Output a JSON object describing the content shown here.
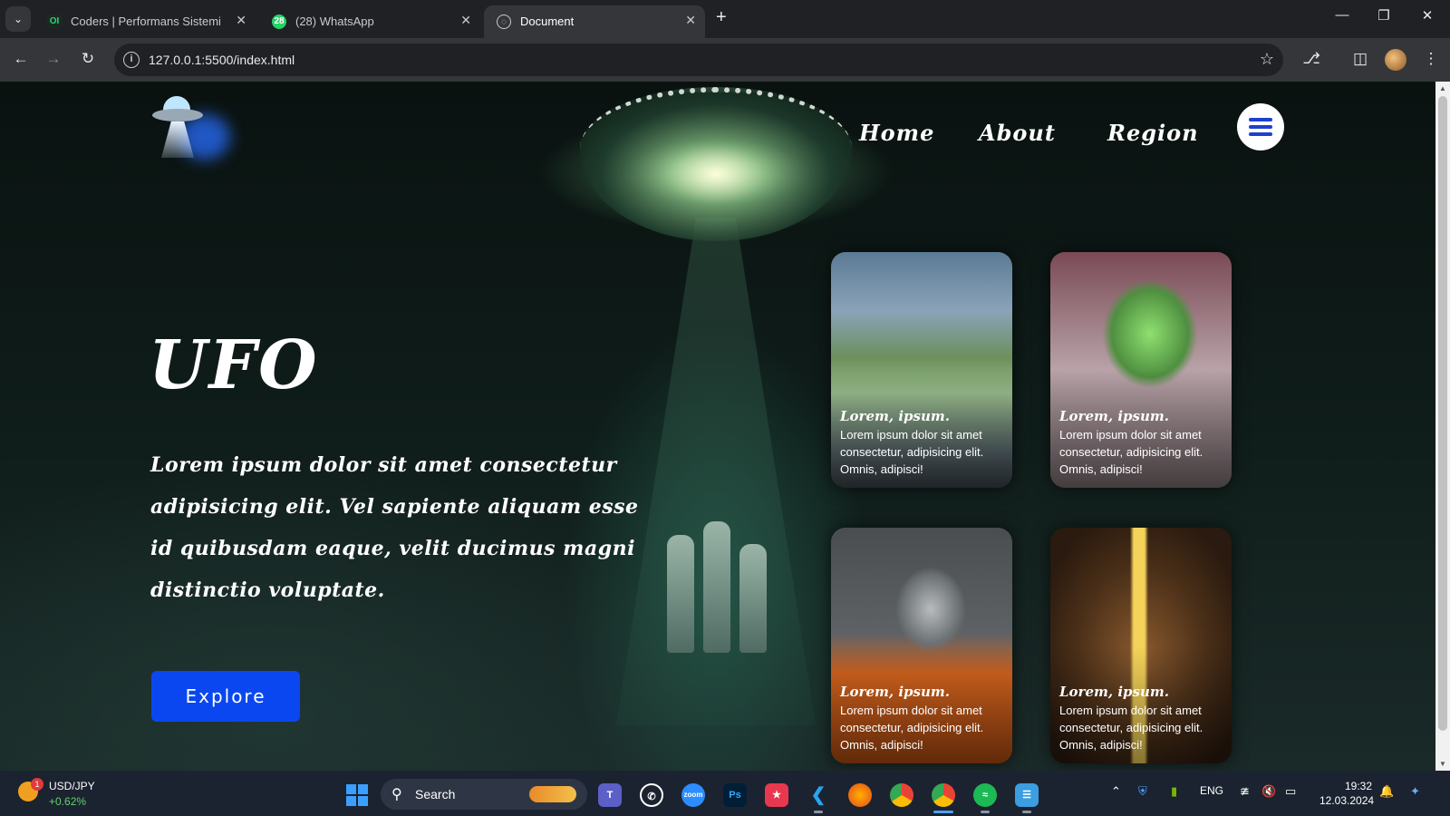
{
  "browser": {
    "tabs": [
      {
        "title": "Coders | Performans Sistemi",
        "favicon": "OI",
        "active": false
      },
      {
        "title": "(28) WhatsApp",
        "favicon": "28",
        "active": false
      },
      {
        "title": "Document",
        "favicon": "globe-icon",
        "active": true
      }
    ],
    "url": "127.0.0.1:5500/index.html"
  },
  "site": {
    "nav": [
      "Home",
      "About",
      "Region"
    ],
    "hero_title": "UFO",
    "hero_text": "Lorem ipsum dolor sit amet consectetur adipisicing elit. Vel sapiente aliquam esse id quibusdam eaque, velit ducimus magni distinctio voluptate.",
    "explore_label": "Explore",
    "cards": [
      {
        "title": "Lorem, ipsum.",
        "text": "Lorem ipsum dolor sit amet consectetur, adipisicing elit. Omnis, adipisci!"
      },
      {
        "title": "Lorem, ipsum.",
        "text": "Lorem ipsum dolor sit amet consectetur, adipisicing elit. Omnis, adipisci!"
      },
      {
        "title": "Lorem, ipsum.",
        "text": "Lorem ipsum dolor sit amet consectetur, adipisicing elit. Omnis, adipisci!"
      },
      {
        "title": "Lorem, ipsum.",
        "text": "Lorem ipsum dolor sit amet consectetur, adipisicing elit. Omnis, adipisci!"
      }
    ],
    "accent_color": "#0b47f0"
  },
  "taskbar": {
    "ticker": {
      "name": "USD/JPY",
      "change": "+0.62%",
      "badge": "1"
    },
    "search_label": "Search",
    "apps": [
      "teams-icon",
      "whatsapp-icon",
      "zoom-icon",
      "photoshop-icon",
      "app-icon",
      "vscode-icon",
      "firefox-icon",
      "chrome-icon",
      "chrome-profile-icon",
      "spotify-icon",
      "notepad-icon"
    ],
    "app_labels": {
      "zoom": "zoom",
      "photoshop": "Ps"
    },
    "language": "ENG",
    "time": "19:32",
    "date": "12.03.2024"
  }
}
